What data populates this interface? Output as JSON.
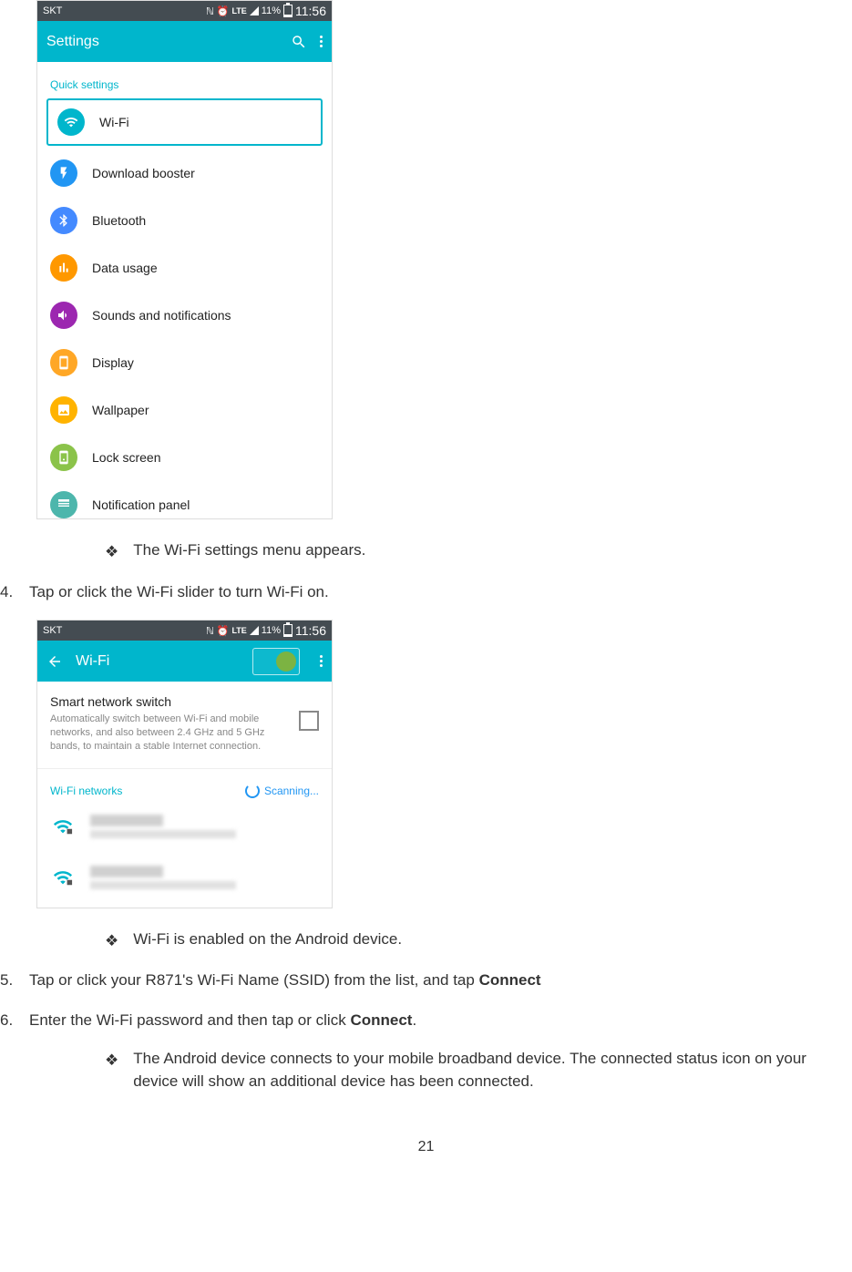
{
  "statusbar": {
    "carrier": "SKT",
    "lte": "LTE",
    "battery_pct": "11%",
    "time": "11:56"
  },
  "screen1": {
    "title": "Settings",
    "section": "Quick settings",
    "items": {
      "wifi": "Wi-Fi",
      "download": "Download booster",
      "bluetooth": "Bluetooth",
      "data": "Data usage",
      "sounds": "Sounds and notifications",
      "display": "Display",
      "wallpaper": "Wallpaper",
      "lock": "Lock screen",
      "notif": "Notification panel"
    }
  },
  "bullets": {
    "b1": "The Wi-Fi settings menu appears.",
    "b2": "Wi-Fi is enabled on the Android device.",
    "b3": "The Android device connects to your mobile broadband device. The connected status icon on your device will show an additional device has been connected."
  },
  "steps": {
    "n4": "4.",
    "s4": "Tap or click the Wi-Fi slider to turn Wi-Fi on.",
    "n5": "5.",
    "s5a": "Tap or click your R871's Wi-Fi Name (SSID) from the list, and tap ",
    "s5b": "Connect",
    "n6": "6.",
    "s6a": "Enter the Wi-Fi password and then tap or click ",
    "s6b": "Connect",
    "s6c": "."
  },
  "screen2": {
    "title": "Wi-Fi",
    "sns_title": "Smart network switch",
    "sns_desc": "Automatically switch between Wi-Fi and mobile networks, and also between 2.4 GHz and 5 GHz bands, to maintain a stable Internet connection.",
    "networks_label": "Wi-Fi networks",
    "scanning": "Scanning..."
  },
  "page_number": "21",
  "diamond_glyph": "❖"
}
